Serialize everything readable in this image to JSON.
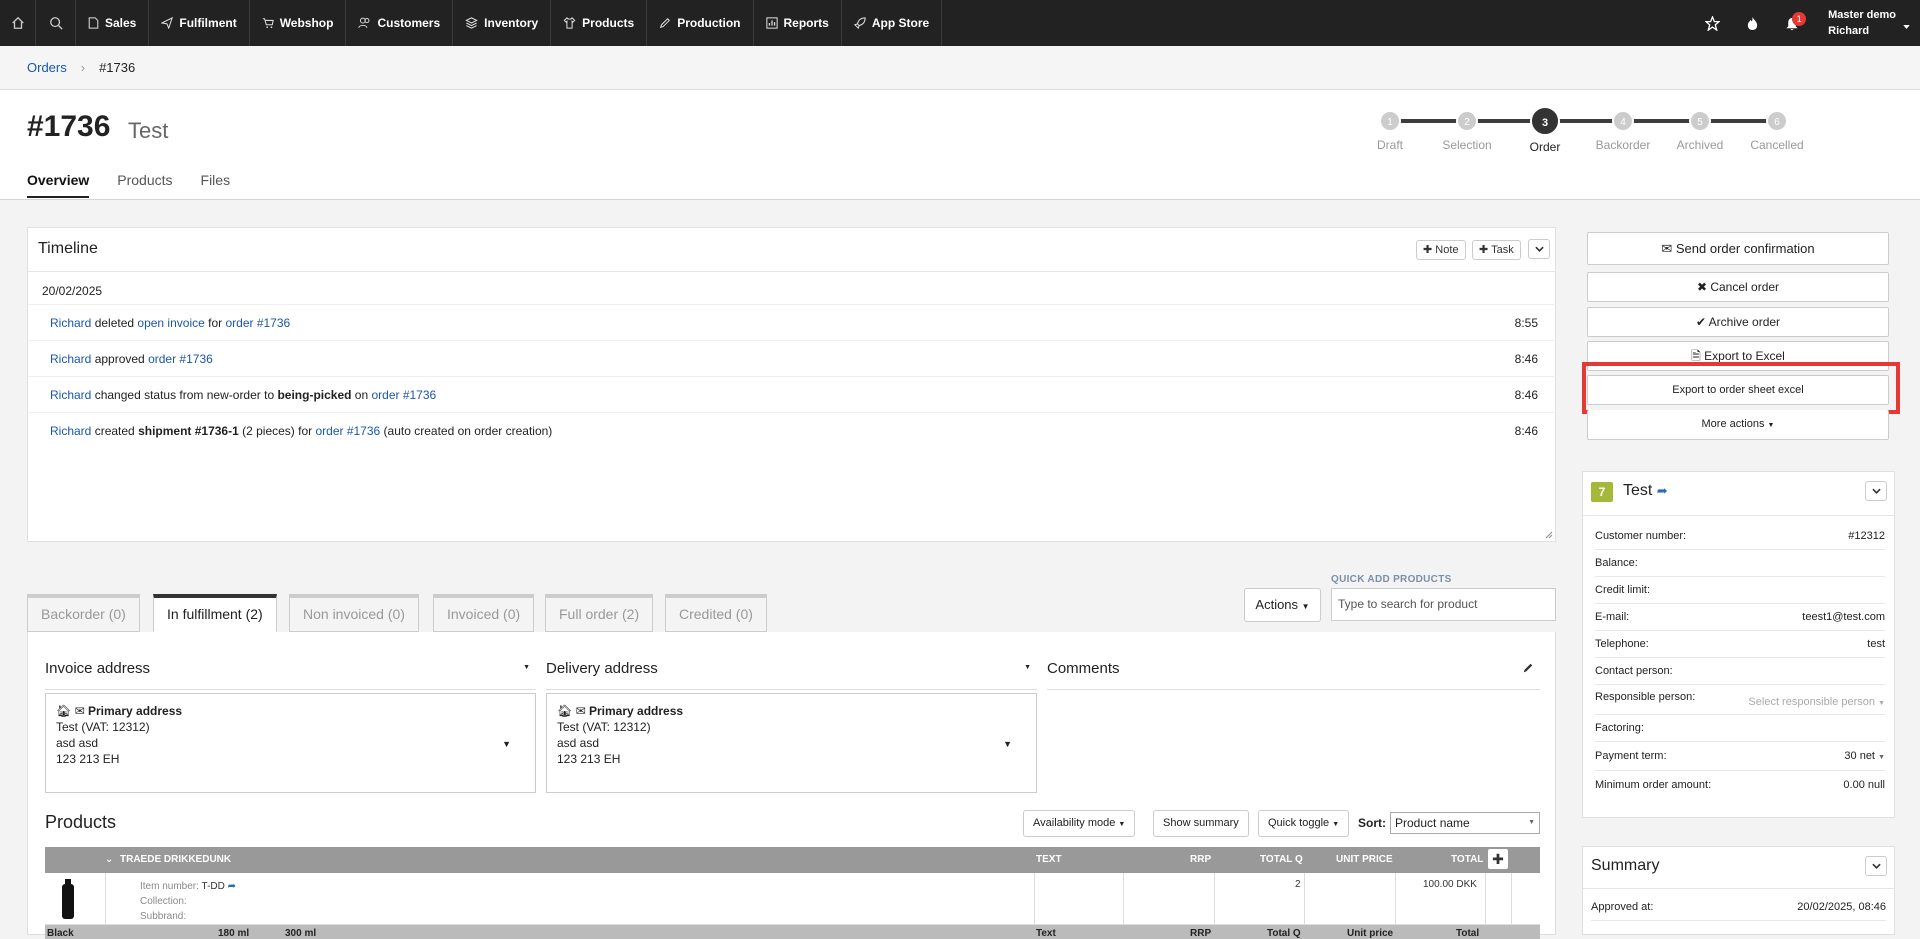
{
  "topnav": {
    "items": [
      {
        "label": "Sales",
        "icon": "document-icon"
      },
      {
        "label": "Fulfilment",
        "icon": "paper-plane-icon"
      },
      {
        "label": "Webshop",
        "icon": "cart-icon"
      },
      {
        "label": "Customers",
        "icon": "users-icon"
      },
      {
        "label": "Inventory",
        "icon": "layers-icon"
      },
      {
        "label": "Products",
        "icon": "shirt-icon"
      },
      {
        "label": "Production",
        "icon": "pencil-icon"
      },
      {
        "label": "Reports",
        "icon": "chart-icon"
      },
      {
        "label": "App Store",
        "icon": "rocket-icon"
      }
    ],
    "notifications": "1",
    "user_company": "Master demo",
    "user_name": "Richard"
  },
  "breadcrumb": {
    "root": "Orders",
    "current": "#1736"
  },
  "order": {
    "number": "#1736",
    "customer": "Test"
  },
  "tabs": [
    "Overview",
    "Products",
    "Files"
  ],
  "steps": [
    {
      "n": "1",
      "label": "Draft"
    },
    {
      "n": "2",
      "label": "Selection"
    },
    {
      "n": "3",
      "label": "Order"
    },
    {
      "n": "4",
      "label": "Backorder"
    },
    {
      "n": "5",
      "label": "Archived"
    },
    {
      "n": "6",
      "label": "Cancelled"
    }
  ],
  "timeline": {
    "title": "Timeline",
    "note_label": "Note",
    "task_label": "Task",
    "date": "20/02/2025",
    "entries": [
      {
        "user": "Richard",
        "t1": " deleted ",
        "link1": "open invoice",
        "t2": " for ",
        "link2": "order #1736",
        "t3": "",
        "time": "8:55"
      },
      {
        "user": "Richard",
        "t1": " approved ",
        "link1": "",
        "t2": "",
        "link2": "order #1736",
        "t3": "",
        "time": "8:46"
      },
      {
        "user": "Richard",
        "t1": " changed status from new-order to ",
        "bold": "being-picked",
        "t2": " on ",
        "link2": "order #1736",
        "t3": "",
        "time": "8:46"
      },
      {
        "user": "Richard",
        "t1": " created ",
        "bold": "shipment #1736-1",
        "t2": " (2 pieces) for ",
        "link2": "order #1736",
        "t3": " (auto created on order creation)",
        "time": "8:46"
      }
    ]
  },
  "fulfil_tabs": [
    "Backorder (0)",
    "In fulfillment (2)",
    "Non invoiced (0)",
    "Invoiced (0)",
    "Full order (2)",
    "Credited (0)"
  ],
  "actions_label": "Actions",
  "quick_add": {
    "label": "QUICK ADD PRODUCTS",
    "placeholder": "Type to search for product"
  },
  "invoice": {
    "title": "Invoice address",
    "type": "Primary address",
    "line1": "Test (VAT: 12312)",
    "line2": "asd asd",
    "line3": "123 213 EH"
  },
  "delivery": {
    "title": "Delivery address",
    "type": "Primary address",
    "line1": "Test (VAT: 12312)",
    "line2": "asd asd",
    "line3": "123 213 EH"
  },
  "comments_title": "Comments",
  "products": {
    "title": "Products",
    "availability_label": "Availability mode",
    "summary_label": "Show summary",
    "quick_toggle_label": "Quick toggle",
    "sort_label": "Sort:",
    "sort_value": "Product name",
    "columns": {
      "name": "TRAEDE DRIKKEDUNK",
      "text": "TEXT",
      "rrp": "RRP",
      "total_q": "TOTAL Q",
      "unit_price": "UNIT PRICE",
      "total": "TOTAL"
    },
    "row": {
      "item_label": "Item number:",
      "item_value": "T-DD",
      "collection_label": "Collection:",
      "subbrand_label": "Subbrand:",
      "qty": "2",
      "total": "100.00 DKK"
    },
    "footer": {
      "variant": "Black",
      "size1": "180 ml",
      "size2": "300 ml",
      "text": "Text",
      "rrp": "RRP",
      "total_q": "Total Q",
      "unit_price": "Unit price",
      "total": "Total"
    }
  },
  "right_actions": {
    "send": "Send order confirmation",
    "cancel": "Cancel order",
    "archive": "Archive order",
    "export_excel": "Export to Excel",
    "export_sheet": "Export to order sheet excel",
    "more": "More actions"
  },
  "customer": {
    "badge": "7",
    "name": "Test",
    "rows": [
      {
        "label": "Customer number:",
        "value": "#12312"
      },
      {
        "label": "Balance:",
        "value": ""
      },
      {
        "label": "Credit limit:",
        "value": ""
      },
      {
        "label": "E-mail:",
        "value": "teest1@test.com"
      },
      {
        "label": "Telephone:",
        "value": "test"
      },
      {
        "label": "Contact person:",
        "value": ""
      },
      {
        "label": "Responsible person:",
        "value": "Select responsible person"
      },
      {
        "label": "Factoring:",
        "value": ""
      },
      {
        "label": "Payment term:",
        "value": "30 net"
      },
      {
        "label": "Minimum order amount:",
        "value": "0.00 null"
      }
    ]
  },
  "summary": {
    "title": "Summary",
    "approved_label": "Approved at:",
    "approved_value": "20/02/2025, 08:46"
  }
}
